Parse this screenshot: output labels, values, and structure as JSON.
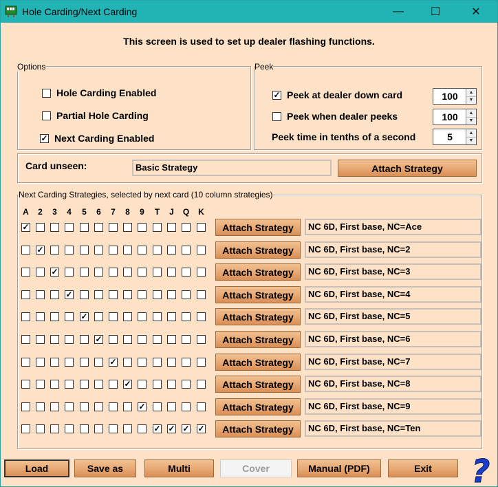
{
  "window": {
    "title": "Hole Carding/Next Carding"
  },
  "titlebar": {
    "minimize": "—",
    "maximize": "☐",
    "close": "✕"
  },
  "headline": "This screen is used to set up dealer flashing functions.",
  "options": {
    "label": "Options",
    "hole_carding": {
      "label": "Hole Carding Enabled",
      "checked": false
    },
    "partial_hole": {
      "label": "Partial Hole Carding",
      "checked": false
    },
    "next_carding": {
      "label": "Next Carding Enabled",
      "checked": true
    }
  },
  "peek": {
    "label": "Peek",
    "down_card": {
      "label": "Peek at dealer down card",
      "checked": true,
      "value": "100"
    },
    "dealer_peeks": {
      "label": "Peek when dealer peeks",
      "checked": false,
      "value": "100"
    },
    "time": {
      "label": "Peek time in tenths of a second",
      "value": "5"
    }
  },
  "card_unseen": {
    "label": "Card unseen:",
    "value": "Basic Strategy",
    "button": "Attach Strategy"
  },
  "next_carding": {
    "label": "Next Carding Strategies, selected by next card (10 column strategies)",
    "columns": [
      "A",
      "2",
      "3",
      "4",
      "5",
      "6",
      "7",
      "8",
      "9",
      "T",
      "J",
      "Q",
      "K"
    ],
    "button": "Attach Strategy",
    "rows": [
      {
        "checked": [
          0
        ],
        "strategy": "NC 6D, First base, NC=Ace"
      },
      {
        "checked": [
          1
        ],
        "strategy": "NC 6D, First base, NC=2"
      },
      {
        "checked": [
          2
        ],
        "strategy": "NC 6D, First base, NC=3"
      },
      {
        "checked": [
          3
        ],
        "strategy": "NC 6D, First base, NC=4"
      },
      {
        "checked": [
          4
        ],
        "strategy": "NC 6D, First base, NC=5"
      },
      {
        "checked": [
          5
        ],
        "strategy": "NC 6D, First base, NC=6"
      },
      {
        "checked": [
          6
        ],
        "strategy": "NC 6D, First base, NC=7"
      },
      {
        "checked": [
          7
        ],
        "strategy": "NC 6D, First base, NC=8"
      },
      {
        "checked": [
          8
        ],
        "strategy": "NC 6D, First base, NC=9"
      },
      {
        "checked": [
          9,
          10,
          11,
          12
        ],
        "strategy": "NC 6D, First base, NC=Ten"
      }
    ]
  },
  "bottom": {
    "load": "Load",
    "save_as": "Save as",
    "multi": "Multi",
    "cover": "Cover",
    "manual": "Manual (PDF)",
    "exit": "Exit"
  },
  "icons": {
    "help": "help-question-icon",
    "app": "app-icon"
  },
  "colors": {
    "titlebar": "#22b4b4",
    "background": "#fde2c8",
    "help": "#1a3cc8"
  }
}
